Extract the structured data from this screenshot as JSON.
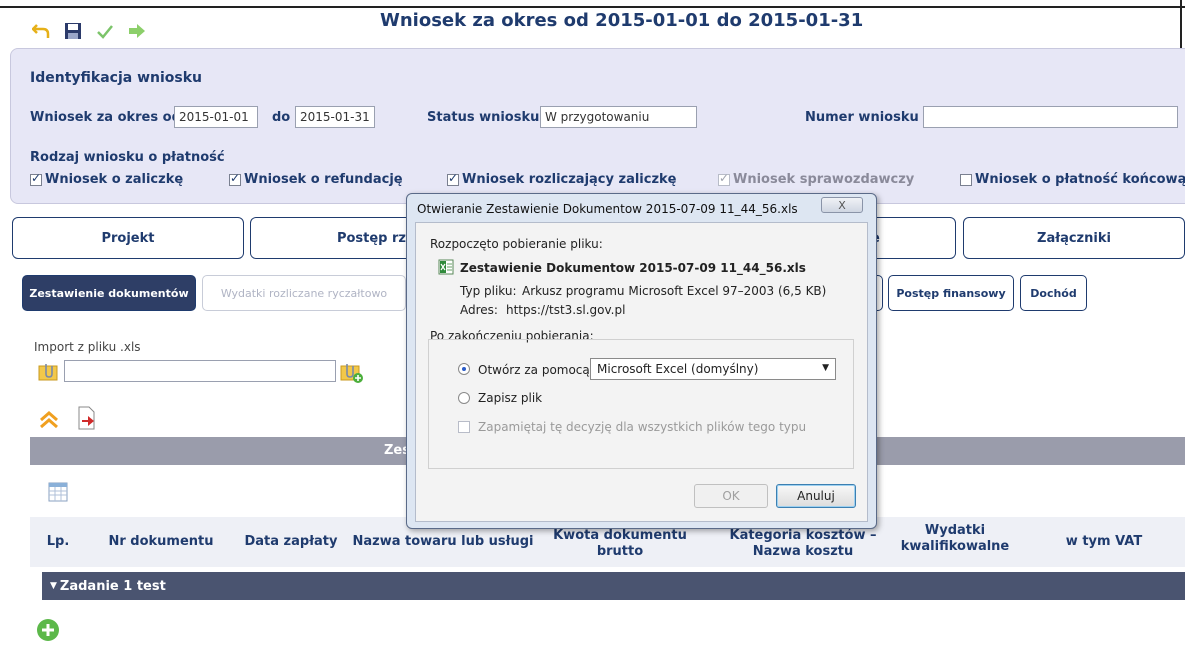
{
  "window": {
    "title": "Wniosek za okres od 2015-01-01 do 2015-01-31"
  },
  "toolbar": {
    "icons": [
      "undo-icon",
      "save-icon",
      "check-icon",
      "forward-arrow-icon"
    ]
  },
  "identification": {
    "section_title": "Identyfikacja wniosku",
    "period_from_label": "Wniosek za okres od",
    "period_from_value": "2015-01-01",
    "period_to_label": "do",
    "period_to_value": "2015-01-31",
    "status_label": "Status wniosku",
    "status_value": "W przygotowaniu",
    "number_label": "Numer wniosku",
    "number_value": "",
    "payment_type_label": "Rodzaj wniosku o płatność",
    "payment_types": [
      {
        "label": "Wniosek o zaliczkę",
        "checked": true,
        "disabled": false
      },
      {
        "label": "Wniosek o refundację",
        "checked": true,
        "disabled": false
      },
      {
        "label": "Wniosek rozliczający zaliczkę",
        "checked": true,
        "disabled": false
      },
      {
        "label": "Wniosek sprawozdawczy",
        "checked": true,
        "disabled": true
      },
      {
        "label": "Wniosek o płatność końcową",
        "checked": false,
        "disabled": false
      }
    ]
  },
  "main_tabs": [
    "Projekt",
    "Postęp rzeczo",
    "e",
    "Załączniki"
  ],
  "sub_tabs": {
    "zestawienie": "Zestawienie dokumentów",
    "wydatki": "Wydatki rozliczane ryczałtowo",
    "postep_fin": "Postęp finansowy",
    "dochod": "Dochód"
  },
  "import": {
    "label": "Import z pliku .xls",
    "value": ""
  },
  "table": {
    "bar_title": "Zes",
    "columns": {
      "lp": "Lp.",
      "nr": "Nr dokumentu",
      "data": "Data zapłaty",
      "nazwa": "Nazwa towaru lub usługi",
      "kwota": "Kwota dokumentu brutto",
      "kategoria": "Kategoria kosztów – Nazwa kosztu",
      "wydatki": "Wydatki kwalifikowalne",
      "vat": "w tym VAT"
    },
    "task_title": "Zadanie 1 test"
  },
  "dialog": {
    "title": "Otwieranie Zestawienie Dokumentow 2015-07-09 11_44_56.xls",
    "close_label": "X",
    "intro": "Rozpoczęto pobieranie pliku:",
    "file_name": "Zestawienie Dokumentow 2015-07-09 11_44_56.xls",
    "file_type_label": "Typ pliku:",
    "file_type_value": "Arkusz programu Microsoft Excel 97–2003 (6,5 KB)",
    "address_label": "Adres:",
    "address_value": "https://tst3.sl.gov.pl",
    "group_title": "Po zakończeniu pobierania:",
    "open_with_label": "Otwórz za pomocą",
    "open_with_value": "Microsoft Excel (domyślny)",
    "save_label": "Zapisz plik",
    "remember_label": "Zapamiętaj tę decyzję dla wszystkich plików tego typu",
    "ok_label": "OK",
    "cancel_label": "Anuluj"
  }
}
